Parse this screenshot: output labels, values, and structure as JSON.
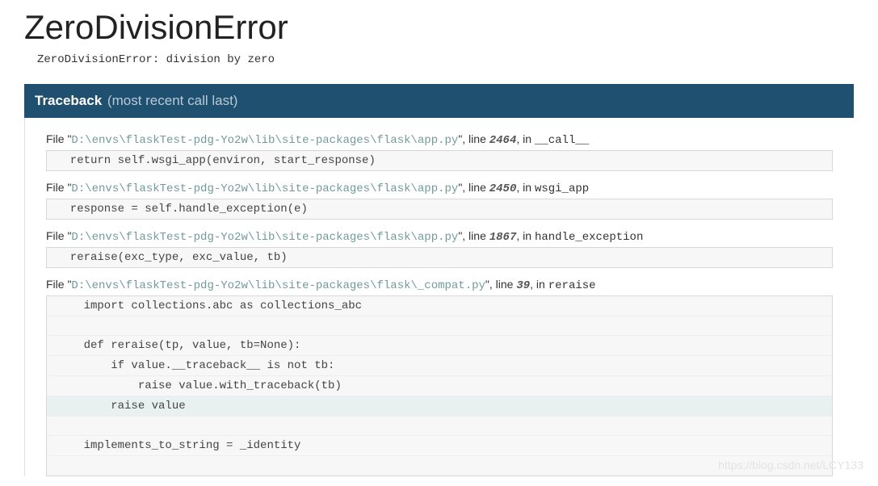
{
  "title": "ZeroDivisionError",
  "exception_message": "ZeroDivisionError: division by zero",
  "traceback_header": {
    "label": "Traceback",
    "subtitle": "(most recent call last)"
  },
  "frames": [
    {
      "prefix": "File \"",
      "path": "D:\\envs\\flaskTest-pdg-Yo2w\\lib\\site-packages\\flask\\app.py",
      "mid": "\", line ",
      "line": "2464",
      "in": ", in ",
      "func": "__call__",
      "code": [
        {
          "text": "  return self.wsgi_app(environ, start_response)",
          "current": false
        }
      ]
    },
    {
      "prefix": "File \"",
      "path": "D:\\envs\\flaskTest-pdg-Yo2w\\lib\\site-packages\\flask\\app.py",
      "mid": "\", line ",
      "line": "2450",
      "in": ", in ",
      "func": "wsgi_app",
      "code": [
        {
          "text": "  response = self.handle_exception(e)",
          "current": false
        }
      ]
    },
    {
      "prefix": "File \"",
      "path": "D:\\envs\\flaskTest-pdg-Yo2w\\lib\\site-packages\\flask\\app.py",
      "mid": "\", line ",
      "line": "1867",
      "in": ", in ",
      "func": "handle_exception",
      "code": [
        {
          "text": "  reraise(exc_type, exc_value, tb)",
          "current": false
        }
      ]
    },
    {
      "prefix": "File \"",
      "path": "D:\\envs\\flaskTest-pdg-Yo2w\\lib\\site-packages\\flask\\_compat.py",
      "mid": "\", line ",
      "line": "39",
      "in": ", in ",
      "func": "reraise",
      "code": [
        {
          "text": "    import collections.abc as collections_abc",
          "current": false
        },
        {
          "text": "",
          "current": false,
          "blank": true
        },
        {
          "text": "    def reraise(tp, value, tb=None):",
          "current": false
        },
        {
          "text": "        if value.__traceback__ is not tb:",
          "current": false
        },
        {
          "text": "            raise value.with_traceback(tb)",
          "current": false
        },
        {
          "text": "        raise value",
          "current": true
        },
        {
          "text": "",
          "current": false,
          "blank": true
        },
        {
          "text": "    implements_to_string = _identity",
          "current": false
        },
        {
          "text": "",
          "current": false,
          "blank": true
        }
      ]
    }
  ],
  "watermark": "https://blog.csdn.net/LCY133"
}
